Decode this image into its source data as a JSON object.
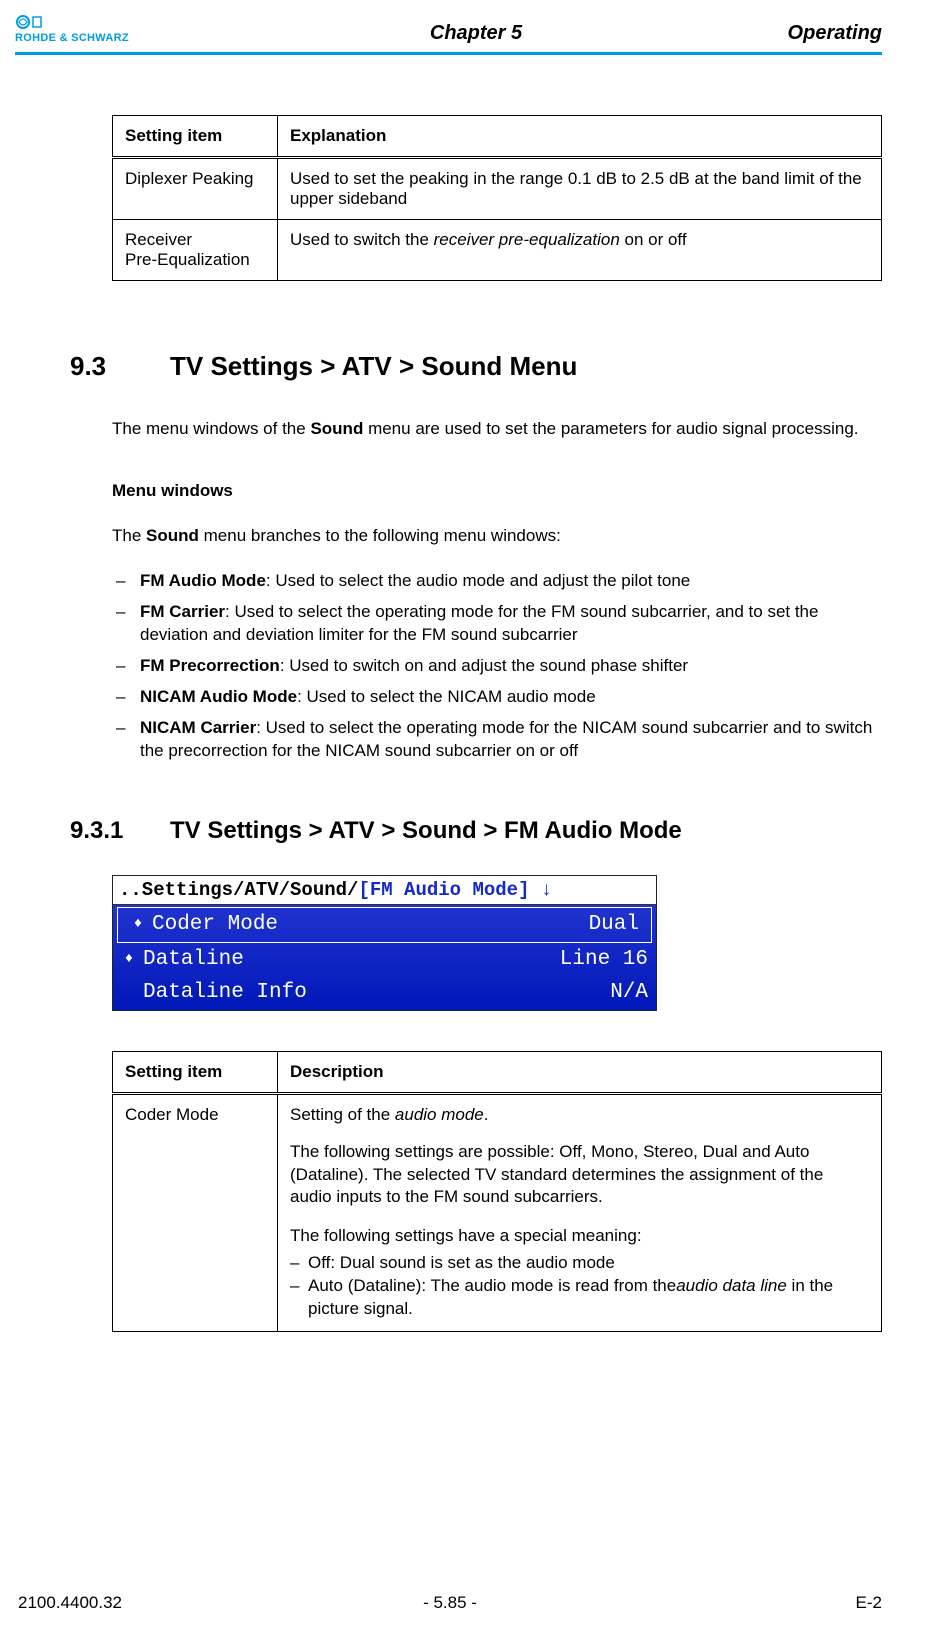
{
  "header": {
    "brand": "ROHDE & SCHWARZ",
    "chapter": "Chapter 5",
    "section": "Operating"
  },
  "table1": {
    "headers": [
      "Setting item",
      "Explanation"
    ],
    "rows": [
      {
        "item": "Diplexer Peaking",
        "text": "Used to set the peaking in the range 0.1 dB to 2.5 dB at the band limit of the upper sideband"
      },
      {
        "item": "Receiver Pre-Equalization",
        "prefix": "Used to switch the ",
        "italic": "receiver pre-equalization",
        "suffix": " on or off"
      }
    ]
  },
  "sec93": {
    "num": "9.3",
    "title": "TV Settings > ATV > Sound Menu",
    "intro_pre": "The menu windows of the ",
    "intro_bold": "Sound",
    "intro_post": " menu are used to set the parameters for audio signal processing.",
    "menuwin": "Menu windows",
    "branches_pre": "The ",
    "branches_bold": "Sound",
    "branches_post": " menu branches to the following menu windows:",
    "items": [
      {
        "b": "FM Audio Mode",
        "t": ": Used to select the audio mode and adjust the pilot tone"
      },
      {
        "b": "FM Carrier",
        "t": ": Used to select the operating mode for the FM sound subcarrier, and to set the deviation and deviation limiter for the FM sound subcarrier"
      },
      {
        "b": "FM Precorrection",
        "t": ": Used to switch on and adjust the sound phase shifter"
      },
      {
        "b": "NICAM Audio Mode",
        "t": ": Used to select the NICAM audio mode"
      },
      {
        "b": "NICAM Carrier",
        "t": ": Used to select the operating mode for the NICAM sound subcarrier and to switch the precorrection for the NICAM sound subcarrier on or off"
      }
    ]
  },
  "sec931": {
    "num": "9.3.1",
    "title": "TV Settings > ATV > Sound > FM Audio Mode"
  },
  "screenshot": {
    "path_prefix": "..Settings/ATV/Sound/",
    "path_sel": "[FM Audio Mode]",
    "path_arrow": "↓",
    "rows": [
      {
        "l": "Coder Mode",
        "r": "Dual",
        "sel": true
      },
      {
        "l": "Dataline",
        "r": "Line 16",
        "sel": false
      },
      {
        "l": "Dataline Info",
        "r": "N/A",
        "sel": false
      }
    ]
  },
  "table2": {
    "headers": [
      "Setting item",
      "Description"
    ],
    "row": {
      "item": "Coder Mode",
      "p1_pre": "Setting of the ",
      "p1_it": "audio mode",
      "p1_post": ".",
      "p2": "The following settings are possible: Off, Mono, Stereo, Dual and Auto (Dataline). The selected TV standard determines the assignment of the audio inputs to the FM sound subcarriers.",
      "p3": "The following settings have a special meaning:",
      "li1": "Off: Dual sound is set as the audio mode",
      "li2_pre": "Auto (Dataline): The audio mode is read from the",
      "li2_it": "audio data line",
      "li2_post": " in the picture signal."
    }
  },
  "footer": {
    "left": "2100.4400.32",
    "center": "- 5.85 -",
    "right": "E-2"
  }
}
